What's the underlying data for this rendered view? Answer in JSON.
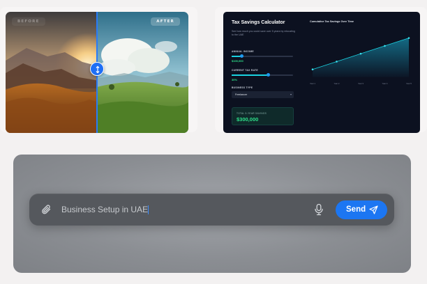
{
  "before_after": {
    "before_label": "BEFORE",
    "after_label": "AFTER",
    "split_fraction": 0.5
  },
  "tax_calculator": {
    "title": "Tax Savings Calculator",
    "description": "See how much you could save over 5 years by relocating to the UAE",
    "annual_income": {
      "label": "ANNUAL INCOME",
      "value": "$100,000",
      "fraction": 0.17
    },
    "current_tax_rate": {
      "label": "CURRENT TAX RATE",
      "value": "30%",
      "fraction": 0.6
    },
    "business_type": {
      "label": "BUSINESS TYPE",
      "selected": "Freelancer"
    },
    "total_savings": {
      "label": "TOTAL 5-YEAR SAVINGS",
      "value": "$300,000"
    },
    "colors": {
      "accent_green": "#2ee08a",
      "accent_cyan": "#1ad2e0",
      "background": "#0c1120"
    },
    "chart_data": {
      "type": "area",
      "title": "Cumulative Tax Savings Over Time",
      "x": [
        "Year 1",
        "Year 2",
        "Year 3",
        "Year 4",
        "Year 5"
      ],
      "series": [
        {
          "values": [
            60000,
            120000,
            180000,
            240000,
            300000
          ]
        }
      ],
      "ylim": [
        0,
        330000
      ],
      "grid": false
    }
  },
  "chat": {
    "placeholder": "Business Setup in UAE",
    "input_value": "Business Setup in UAE",
    "send_label": "Send",
    "icons": {
      "attach": "paperclip-icon",
      "mic": "microphone-icon",
      "send": "paper-plane-icon"
    },
    "colors": {
      "send_button": "#1c76f2"
    }
  }
}
